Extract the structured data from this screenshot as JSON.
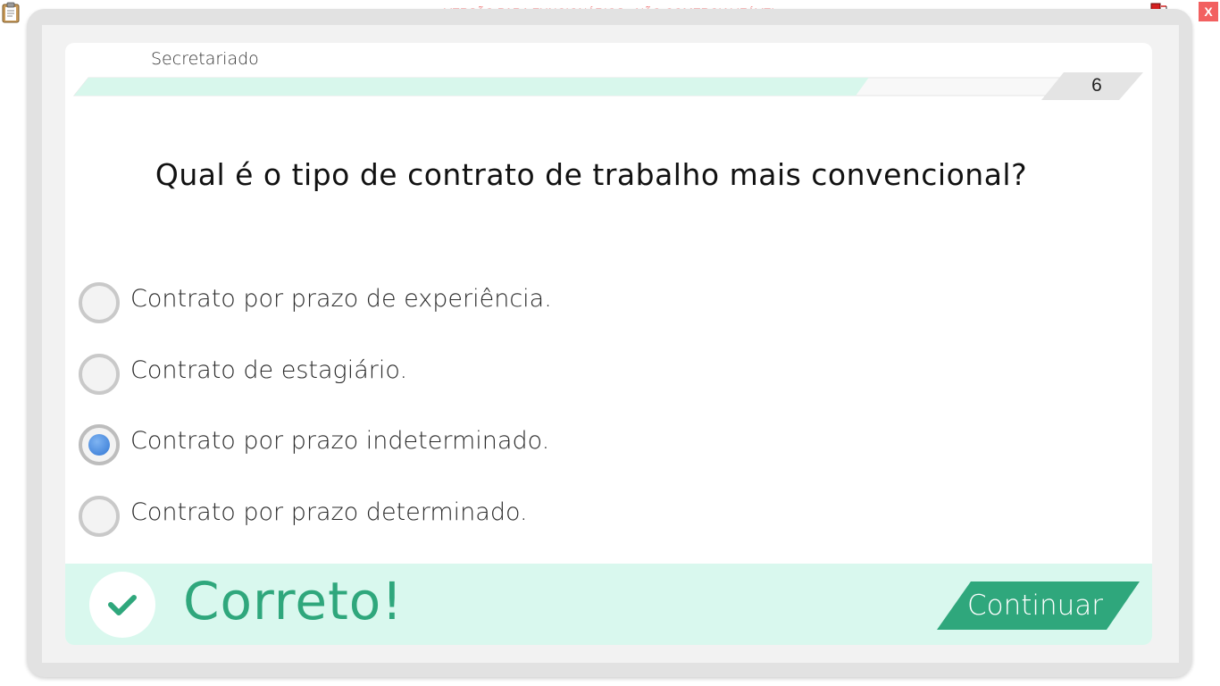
{
  "window": {
    "watermark": "VERSÃO PARA FUNCIONÁRIOS - NÃO COMERCIALIZÁVEL",
    "close_label": "X",
    "icons": {
      "clipboard": "clipboard-icon",
      "network": "network-status-icon"
    }
  },
  "header": {
    "course_title": "Secretariado",
    "progress": 0.8,
    "page_number": "6"
  },
  "question": {
    "text": "Qual é o tipo de contrato de trabalho mais convencional?"
  },
  "options": [
    {
      "label": "Contrato por prazo de experiência.",
      "selected": false
    },
    {
      "label": "Contrato de estagiário.",
      "selected": false
    },
    {
      "label": "Contrato por prazo indeterminado.",
      "selected": true
    },
    {
      "label": "Contrato por prazo determinado.",
      "selected": false
    }
  ],
  "feedback": {
    "icon": "check-icon",
    "text": "Correto!",
    "continue_label": "Continuar"
  },
  "colors": {
    "accent": "#2fa77c",
    "feedback_background": "#d9f8ee",
    "progress_fill": "#d8f7ec",
    "radio_selected": "#3a7fd8",
    "watermark": "#f07a7a",
    "close_button": "#f26060"
  }
}
